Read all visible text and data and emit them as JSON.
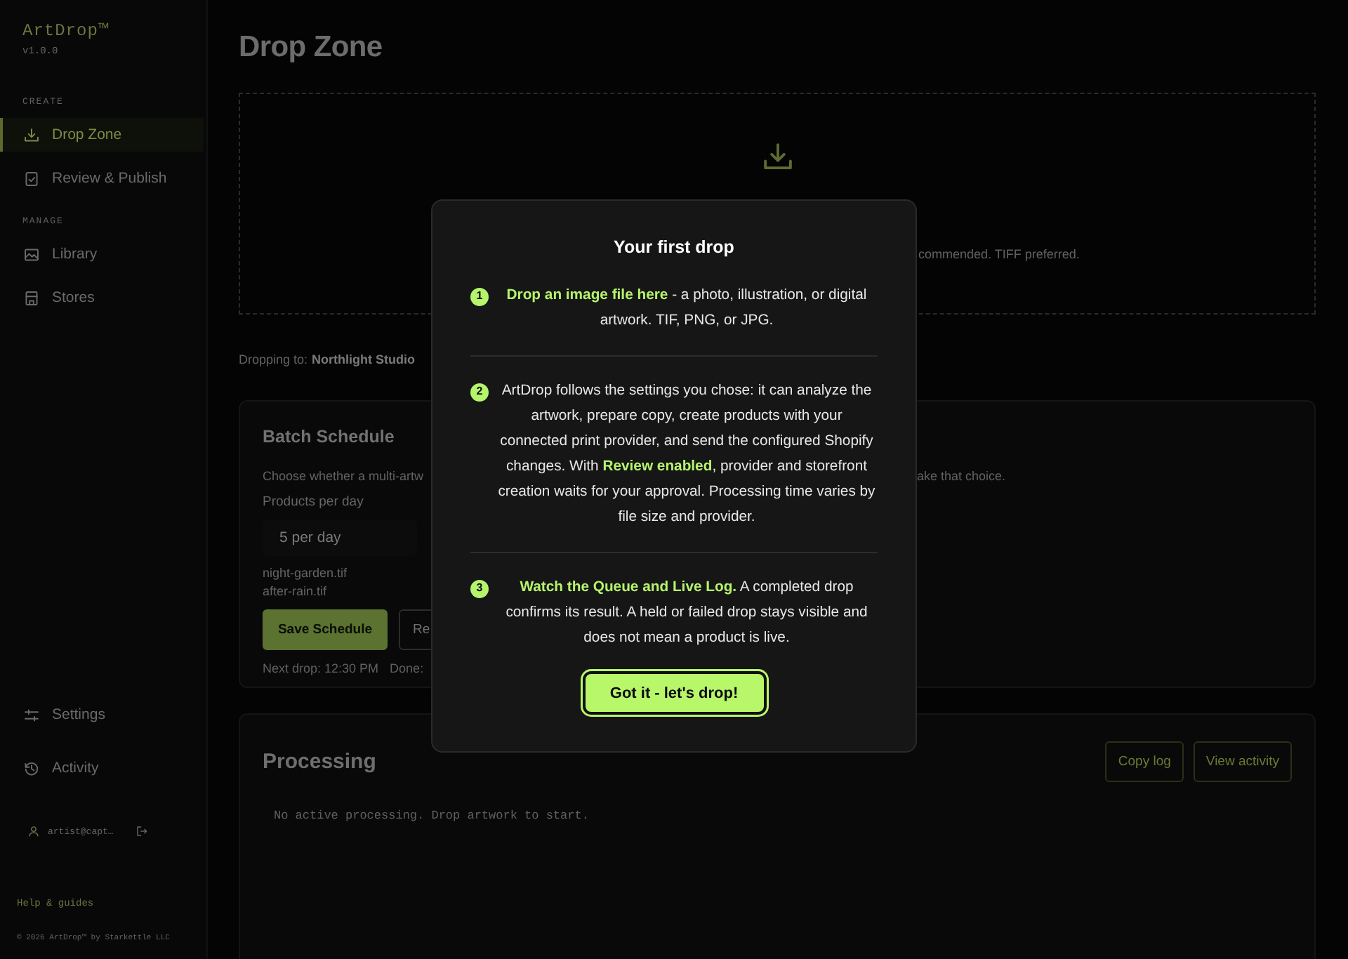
{
  "sidebar": {
    "logo": "ArtDrop™",
    "version": "v1.0.0",
    "sections": [
      {
        "heading": "CREATE",
        "items": [
          {
            "label": "Drop Zone",
            "selected": true
          },
          {
            "label": "Review & Publish",
            "selected": false
          }
        ]
      },
      {
        "heading": "MANAGE",
        "items": [
          {
            "label": "Library",
            "selected": false
          },
          {
            "label": "Stores",
            "selected": false
          }
        ]
      }
    ],
    "bottom_items": [
      {
        "label": "Settings",
        "selected": false
      },
      {
        "label": "Activity",
        "selected": false
      }
    ],
    "account": {
      "email": "artist@capt…"
    },
    "help_link": "Help & guides",
    "copyright": "© 2026 ArtDrop™ by Starkettle LLC"
  },
  "page_title": "Drop Zone",
  "drop_zone": {
    "hint": "commended. TIFF preferred."
  },
  "target": {
    "label": "Dropping to:",
    "value": "Northlight Studio"
  },
  "batch_schedule": {
    "title": "Batch Schedule",
    "description_start": "Choose whether a multi-artw",
    "description_end": "ake that choice.",
    "field_label": "Products per day",
    "select_value": "5 per day",
    "files": [
      "night-garden.tif",
      "after-rain.tif"
    ],
    "buttons": [
      {
        "label": "Save Schedule",
        "kind": "primary"
      },
      {
        "label": "Re",
        "kind": "outline"
      }
    ],
    "status": [
      "Next drop: 12:30 PM",
      "Done:"
    ]
  },
  "processing": {
    "title": "Processing",
    "buttons": [
      "Copy log",
      "View activity"
    ],
    "log": "No active processing. Drop artwork to start."
  },
  "modal": {
    "title": "Your first drop",
    "steps": [
      {
        "number": "1",
        "text": "**Drop an image file here** - a photo, illustration, or digital artwork. TIF, PNG, or JPG."
      },
      {
        "number": "2",
        "text": "ArtDrop follows the settings you chose: it can analyze the artwork, prepare copy, create products with your connected print provider, and send the configured Shopify changes. With **Review enabled**, provider and storefront creation waits for your approval. Processing time varies by file size and provider."
      },
      {
        "number": "3",
        "text": "**Watch the Queue and Live Log.** A completed drop confirms its result. A held or failed drop stays visible and does not mean a product is live."
      }
    ],
    "button": "Got it - let's drop!"
  }
}
